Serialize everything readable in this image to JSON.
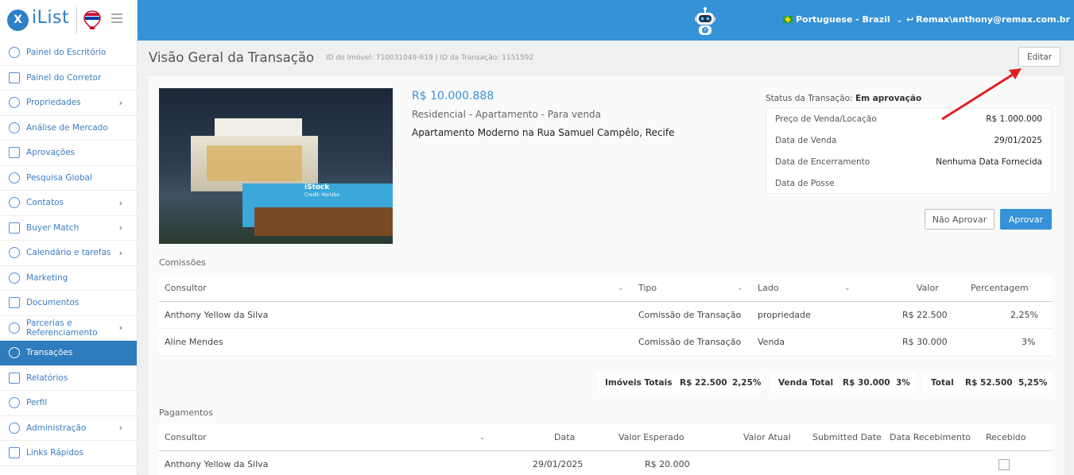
{
  "header": {
    "logo_text": "iList",
    "logo_mark": "X",
    "language": "Portuguese - Brazil",
    "user": "Remax\\anthony@remax.com.br",
    "robot_icon": "robot-assistant-icon"
  },
  "sidebar": {
    "items": [
      {
        "label": "Painel do Escritório",
        "icon": "gauge-icon",
        "chevron": false
      },
      {
        "label": "Painel do Corretor",
        "icon": "gauge-icon",
        "chevron": false
      },
      {
        "label": "Propriedades",
        "icon": "home-icon",
        "chevron": true
      },
      {
        "label": "Análise de Mercado",
        "icon": "bar-chart-icon",
        "chevron": false
      },
      {
        "label": "Aprovações",
        "icon": "eye-icon",
        "chevron": false
      },
      {
        "label": "Pesquisa Global",
        "icon": "search-icon",
        "chevron": false
      },
      {
        "label": "Contatos",
        "icon": "contacts-icon",
        "chevron": true
      },
      {
        "label": "Buyer Match",
        "icon": "hand-icon",
        "chevron": true
      },
      {
        "label": "Calendário e tarefas",
        "icon": "calendar-icon",
        "chevron": true
      },
      {
        "label": "Marketing",
        "icon": "newspaper-icon",
        "chevron": false
      },
      {
        "label": "Documentos",
        "icon": "folder-icon",
        "chevron": false
      },
      {
        "label": "Parcerias e Referenciamento",
        "icon": "handshake-icon",
        "chevron": true
      },
      {
        "label": "Transações",
        "icon": "briefcase-icon",
        "chevron": false,
        "active": true
      },
      {
        "label": "Relatórios",
        "icon": "report-icon",
        "chevron": false
      },
      {
        "label": "Perfil",
        "icon": "user-icon",
        "chevron": false
      },
      {
        "label": "Administração",
        "icon": "gear-icon",
        "chevron": true
      },
      {
        "label": "Links Rápidos",
        "icon": "links-icon",
        "chevron": false
      }
    ]
  },
  "page": {
    "title": "Visão Geral da Transação",
    "ids": "ID do Imóvel: 710031049-619 | ID da Transação: 1151592",
    "edit_label": "Editar"
  },
  "property": {
    "price": "R$ 10.000.888",
    "type": "Residencial - Apartamento - Para venda",
    "address": "Apartamento Moderno na Rua Samuel Campêlo, Recife",
    "photo_mark": "iStock",
    "photo_credit": "Credit: Korisbo"
  },
  "status": {
    "label": "Status da Transação:",
    "value": "Em aprovação",
    "rows": [
      {
        "label": "Preço de Venda/Locação",
        "value": "R$ 1.000.000"
      },
      {
        "label": "Data de Venda",
        "value": "29/01/2025"
      },
      {
        "label": "Data de Encerramento",
        "value": "Nenhuma Data Fornecida"
      },
      {
        "label": "Data de Posse",
        "value": ""
      }
    ],
    "reject_label": "Não Aprovar",
    "approve_label": "Aprovar"
  },
  "commissions": {
    "section_label": "Comissões",
    "headers": {
      "consultor": "Consultor",
      "tipo": "Tipo",
      "lado": "Lado",
      "valor": "Valor",
      "percentagem": "Percentagem"
    },
    "rows": [
      {
        "consultor": "Anthony Yellow da Silva",
        "tipo": "Comissão de Transação",
        "lado": "propriedade",
        "valor": "R$ 22.500",
        "percentagem": "2,25%"
      },
      {
        "consultor": "Aline Mendes",
        "tipo": "Comissão de Transação",
        "lado": "Venda",
        "valor": "R$ 30.000",
        "percentagem": "3%"
      }
    ],
    "totals": [
      {
        "label": "Imóveis Totais",
        "value": "R$ 22.500",
        "pct": "2,25%"
      },
      {
        "label": "Venda Total",
        "value": "R$ 30.000",
        "pct": "3%"
      },
      {
        "label": "Total",
        "value": "R$ 52.500",
        "pct": "5,25%"
      }
    ]
  },
  "payments": {
    "section_label": "Pagamentos",
    "headers": {
      "consultor": "Consultor",
      "data": "Data",
      "valor_esperado": "Valor Esperado",
      "valor_atual": "Valor Atual",
      "submitted": "Submitted Date",
      "recebimento": "Data Recebimento",
      "recebido": "Recebido"
    },
    "rows": [
      {
        "consultor": "Anthony Yellow da Silva",
        "data": "29/01/2025",
        "valor_esperado": "R$ 20.000",
        "valor_atual": "",
        "submitted": "",
        "recebimento": ""
      }
    ]
  },
  "colors": {
    "accent": "#3592d6",
    "active_nav": "#2e7bbd",
    "annotation_arrow": "#e02020"
  }
}
